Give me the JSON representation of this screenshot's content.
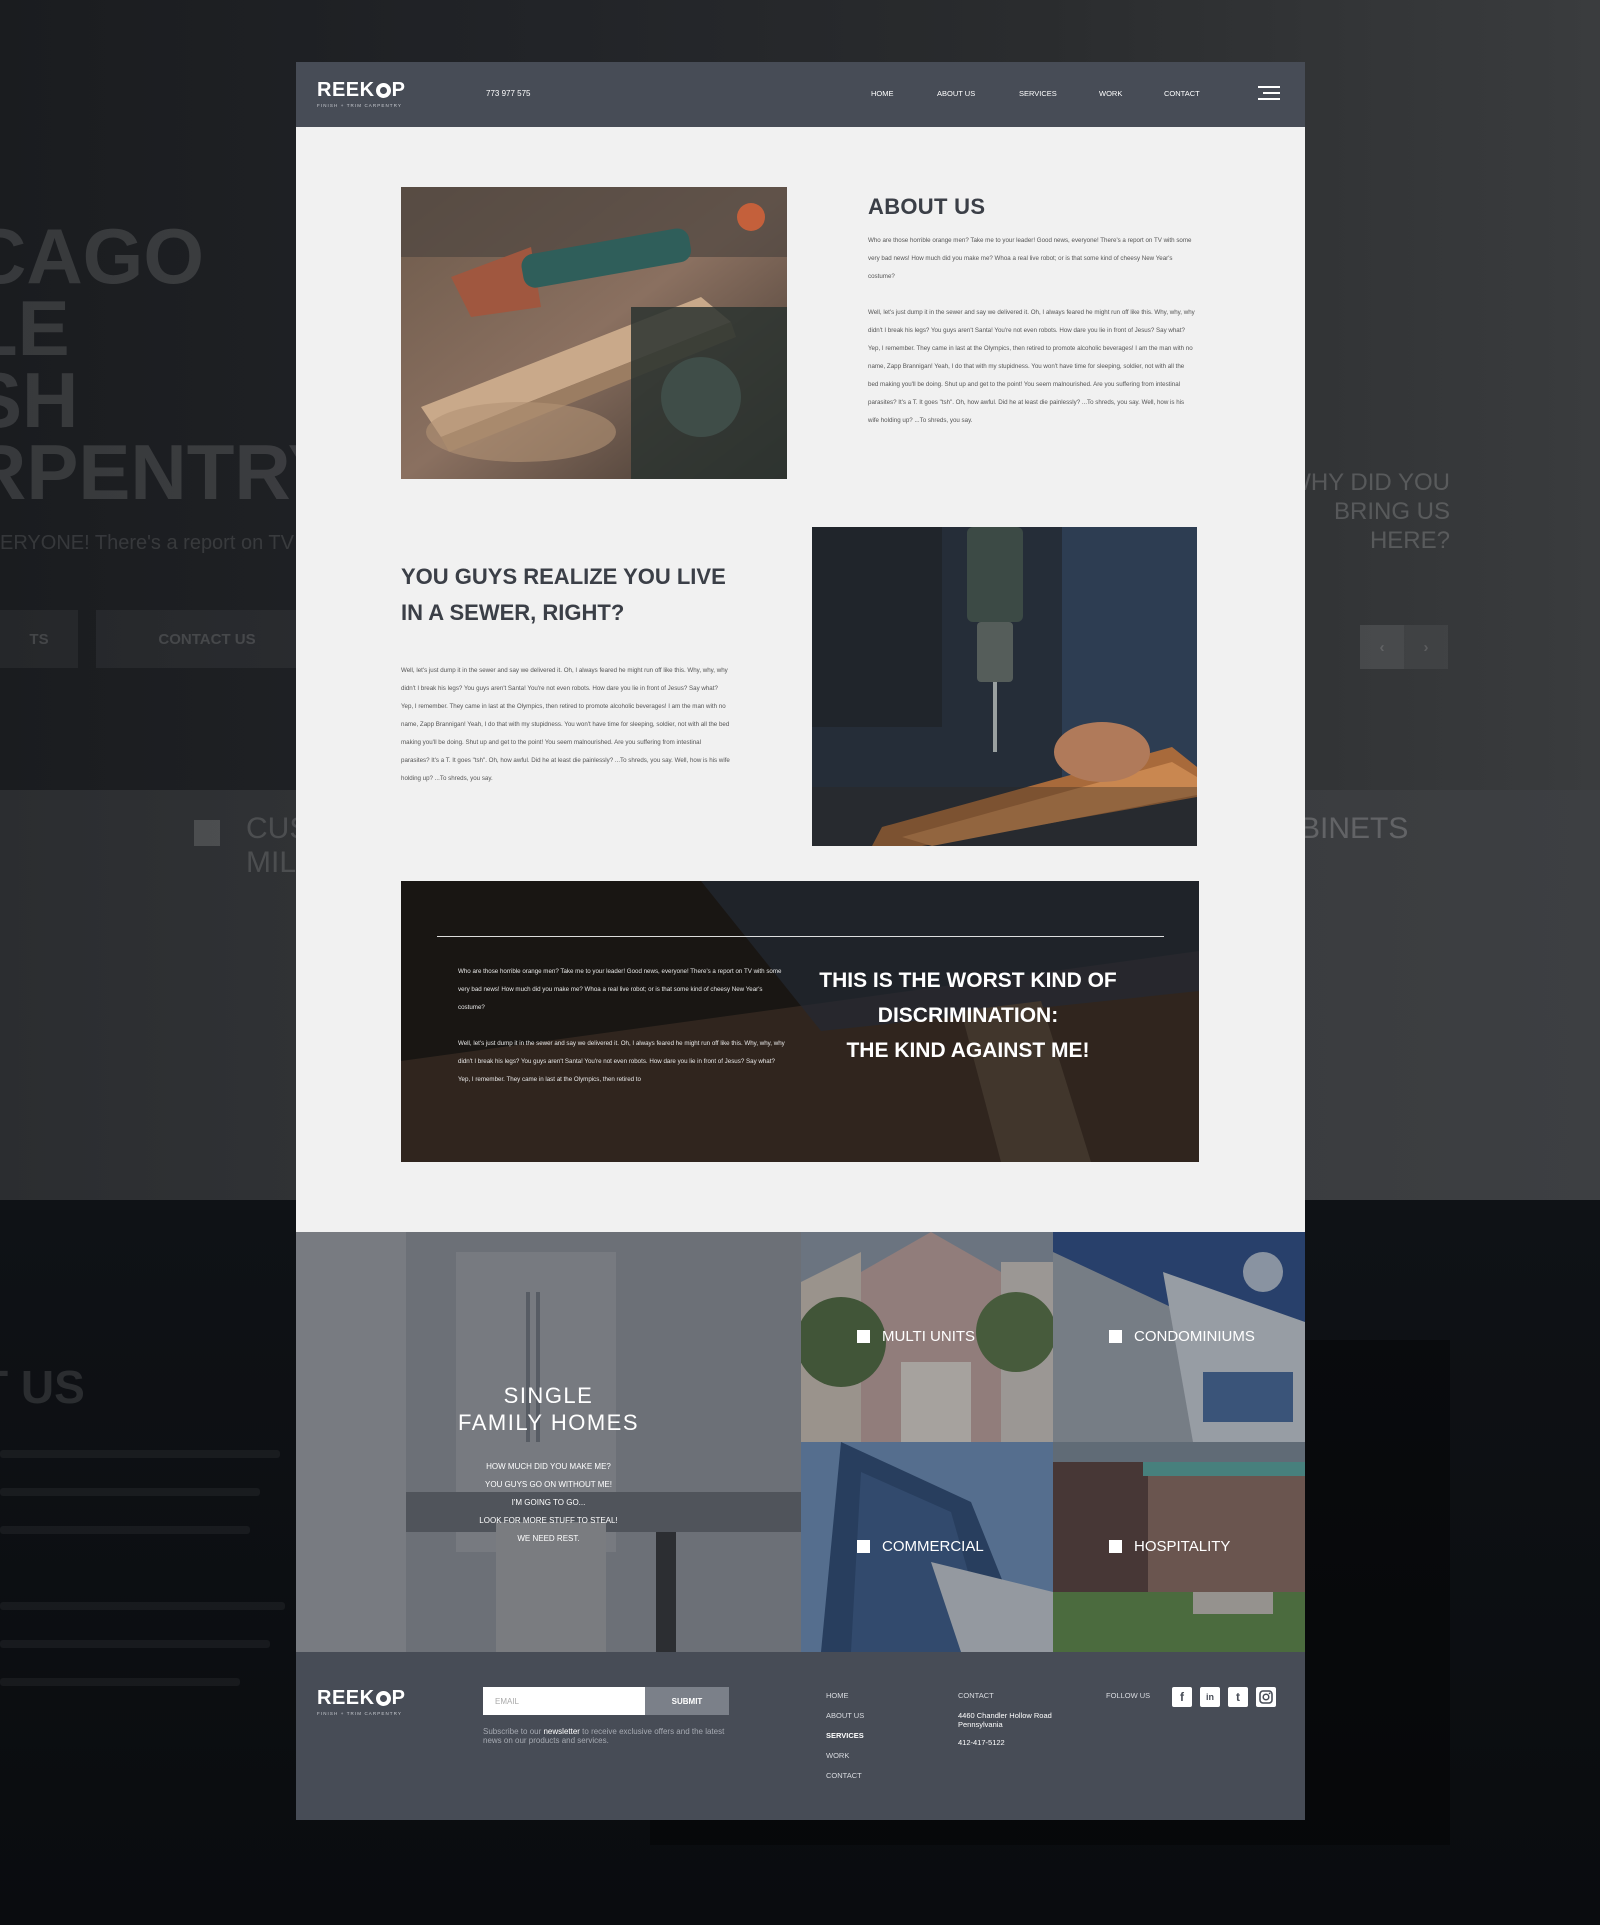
{
  "brand": {
    "name": "REEKOP",
    "name_a": "REEK",
    "name_b": "P",
    "tagline": "FINISH + TRIM CARPENTRY"
  },
  "nav": {
    "phone": "773 977 575",
    "links": [
      "HOME",
      "ABOUT US",
      "SERVICES",
      "WORK",
      "CONTACT"
    ],
    "menu_icon": "hamburger-menu-icon"
  },
  "background": {
    "hero_lines": [
      "CAGO",
      "LE",
      "SH",
      "RPENTRY"
    ],
    "hero_sub": "ERYONE!  There's a report on TV w",
    "btn_left": "TS",
    "btn_contact": "CONTACT US",
    "why": [
      "WHY DID YOU",
      "BRING US",
      "HERE?"
    ],
    "cabinets": "BINETS",
    "cus": [
      "CUS",
      "MIL"
    ],
    "about": "T US"
  },
  "about": {
    "title": "ABOUT US",
    "p1": "Who are those horrible orange men? Take me to your leader! Good news, everyone! There's a report on TV with some very bad news! How much did you make me? Whoa a real live robot; or is that some kind of cheesy New Year's costume?",
    "p2": "Well, let's just dump it in the sewer and say we delivered it. Oh, I always feared he might run off like this. Why, why, why didn't I break his legs? You guys aren't Santa! You're not even robots. How dare you lie in front of Jesus? Say what? Yep, I remember. They came in last at the Olympics, then retired to promote alcoholic beverages! I am the man with no name, Zapp Brannigan! Yeah, I do that with my stupidness. You won't have time for sleeping, soldier, not with all the bed making you'll be doing. Shut up and get to the point! You seem malnourished. Are you suffering from intestinal parasites? It's a T. It goes \"tsh\". Oh, how awful. Did he at least die painlessly? ...To shreds, you say. Well, how is his wife holding up? ...To shreds, you say."
  },
  "sewer": {
    "title_1": "YOU GUYS REALIZE YOU LIVE",
    "title_2": "IN A SEWER, RIGHT?",
    "p": "Well, let's just dump it in the sewer and say we delivered it. Oh, I always feared he might run off like this. Why, why, why didn't I break his legs? You guys aren't Santa! You're not even robots. How dare you lie in front of Jesus? Say what? Yep, I remember. They came in last at the Olympics, then retired to promote alcoholic beverages! I am the man with no name, Zapp Brannigan! Yeah, I do that with my stupidness. You won't have time for sleeping, soldier, not with all the bed making you'll be doing. Shut up and get to the point! You seem malnourished. Are you suffering from intestinal parasites? It's a T. It goes \"tsh\". Oh, how awful. Did he at least die painlessly? ...To shreds, you say. Well, how is his wife holding up? ...To shreds, you say."
  },
  "banner": {
    "p1": "Who are those horrible orange men? Take me to your leader! Good news, everyone! There's a report on TV with some very bad news! How much did you make me? Whoa a real live robot; or is that some kind of cheesy New Year's costume?",
    "p2": "Well, let's just dump it in the sewer and say we delivered it. Oh, I always feared he might run off like this. Why, why, why didn't I break his legs? You guys aren't Santa! You're not even robots. How dare you lie in front of Jesus? Say what? Yep, I remember. They came in last at the Olympics, then retired to",
    "quote_1": "THIS IS THE WORST KIND OF",
    "quote_2": "DISCRIMINATION:",
    "quote_3": "THE KIND AGAINST ME!"
  },
  "services": {
    "single_title_1": "SINGLE",
    "single_title_2": "FAMILY HOMES",
    "single_lines": [
      "HOW MUCH DID YOU MAKE ME?",
      "YOU GUYS GO ON WITHOUT ME!",
      "I'M GOING TO GO...",
      "LOOK FOR MORE STUFF TO STEAL!",
      "WE NEED REST."
    ],
    "tiles": [
      "MULTI UNITS",
      "CONDOMINIUMS",
      "COMMERCIAL",
      "HOSPITALITY"
    ]
  },
  "footer": {
    "email_placeholder": "EMAIL",
    "submit": "SUBMIT",
    "news_1": "Subscribe to our ",
    "news_bold": "newsletter",
    "news_2": " to receive exclusive offers and the latest news on our products and services.",
    "links": [
      "HOME",
      "ABOUT US",
      "SERVICES",
      "WORK",
      "CONTACT"
    ],
    "active_link": "SERVICES",
    "contact_heading": "CONTACT",
    "address": "4460 Chandler Hollow Road Pennsylvania",
    "phone": "412-417-5122",
    "follow": "FOLLOW US",
    "social_icons": [
      "facebook-icon",
      "linkedin-icon",
      "twitter-icon",
      "instagram-icon"
    ],
    "social_glyphs": [
      "f",
      "in",
      "t",
      "o"
    ]
  },
  "colors": {
    "nav": "#474c56",
    "card": "#f1f1f1",
    "heading": "#3b3f47",
    "footer": "#474c56"
  }
}
